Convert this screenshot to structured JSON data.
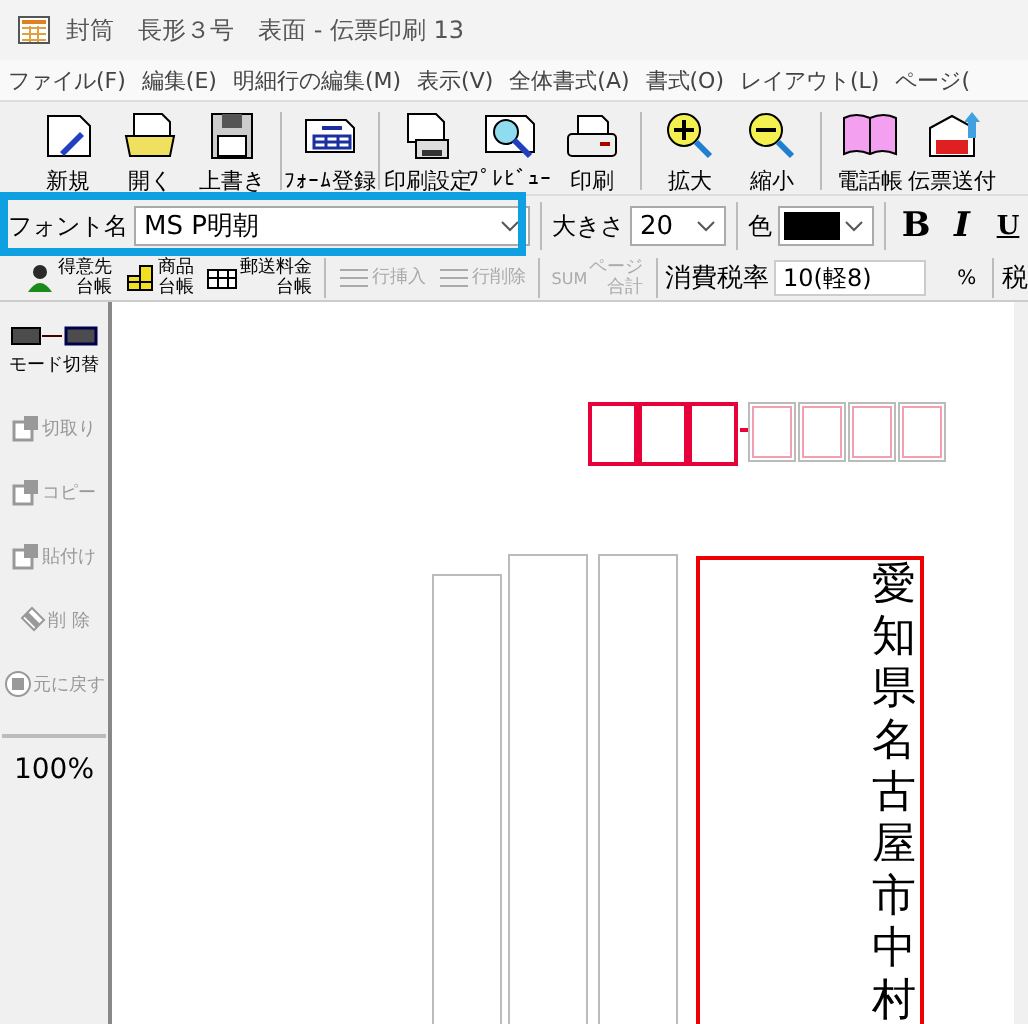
{
  "window": {
    "title": "封筒　長形３号　表面 - 伝票印刷 13"
  },
  "menu": [
    "ファイル(F)",
    "編集(E)",
    "明細行の編集(M)",
    "表示(V)",
    "全体書式(A)",
    "書式(O)",
    "レイアウト(L)",
    "ページ("
  ],
  "toolbar": [
    {
      "kind": "new",
      "label": "新規"
    },
    {
      "kind": "open",
      "label": "開く"
    },
    {
      "kind": "save",
      "label": "上書き"
    },
    {
      "kind": "sep"
    },
    {
      "kind": "form",
      "label": "ﾌｫｰﾑ登録"
    },
    {
      "kind": "sep"
    },
    {
      "kind": "printsetup",
      "label": "印刷設定"
    },
    {
      "kind": "preview",
      "label": "ﾌﾟﾚﾋﾞｭｰ"
    },
    {
      "kind": "print",
      "label": "印刷"
    },
    {
      "kind": "sep"
    },
    {
      "kind": "zoomin",
      "label": "拡大"
    },
    {
      "kind": "zoomout",
      "label": "縮小"
    },
    {
      "kind": "sep"
    },
    {
      "kind": "phonebook",
      "label": "電話帳"
    },
    {
      "kind": "pdf",
      "label": "伝票送付"
    }
  ],
  "format_bar": {
    "font_label": "フォント名",
    "font": "MS P明朝",
    "size_label": "大きさ",
    "size": "20",
    "color_label": "色",
    "color": "#000000",
    "bold": "B",
    "italic": "I",
    "underline": "U"
  },
  "sub_toolbar": [
    {
      "kind": "customer",
      "top": "得意先",
      "bottom": "台帳",
      "disabled": false
    },
    {
      "kind": "product",
      "top": "商品",
      "bottom": "台帳",
      "disabled": false
    },
    {
      "kind": "table",
      "top": "郵送料金",
      "bottom": "台帳",
      "disabled": false
    },
    {
      "kind": "sep"
    },
    {
      "kind": "insert",
      "top": "行挿入",
      "disabled": true
    },
    {
      "kind": "delete",
      "top": "行削除",
      "disabled": true
    },
    {
      "kind": "sep"
    },
    {
      "kind": "sum",
      "icon_text": "SUM",
      "top": "ページ",
      "bottom": "合計",
      "disabled": true
    }
  ],
  "tax": {
    "label": "消費税率",
    "value": "10(軽8)",
    "unit": "%",
    "next": "税"
  },
  "sidebar": [
    {
      "kind": "mode",
      "label": "モード切替",
      "disabled": false
    },
    {
      "kind": "cut",
      "label": "切取り",
      "disabled": true
    },
    {
      "kind": "copy",
      "label": "コピー",
      "disabled": true
    },
    {
      "kind": "paste",
      "label": "貼付け",
      "disabled": true
    },
    {
      "kind": "delete",
      "label": "削 除",
      "disabled": true
    },
    {
      "kind": "undo",
      "label": "元に戻す",
      "disabled": true
    }
  ],
  "zoom": "100%",
  "postal_boxes": [
    {
      "selected": true
    },
    {
      "selected": true
    },
    {
      "selected": true
    },
    {
      "selected": false
    },
    {
      "selected": false
    },
    {
      "selected": false
    },
    {
      "selected": false
    }
  ],
  "columns": [
    {
      "selected": false
    },
    {
      "selected": false
    },
    {
      "selected": false
    },
    {
      "selected": true,
      "text": "愛知県名古屋市中村"
    }
  ]
}
